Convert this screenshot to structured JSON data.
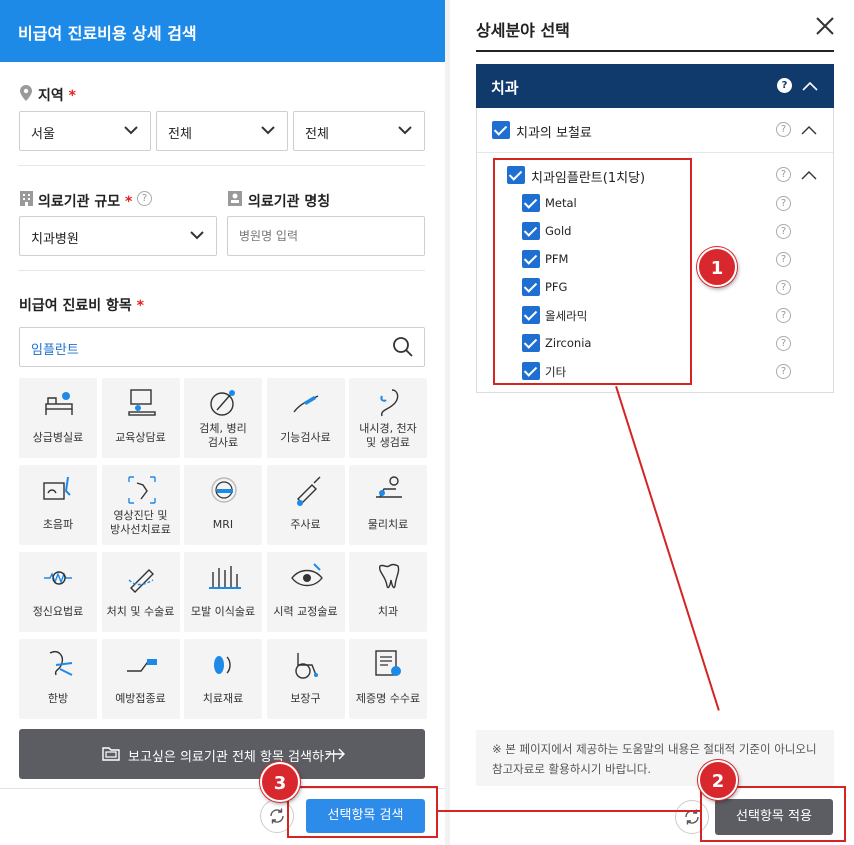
{
  "left": {
    "header_title": "비급여 진료비용 상세 검색",
    "region": {
      "title": "지역",
      "required_mark": "*",
      "selects": [
        "서울",
        "전체",
        "전체"
      ]
    },
    "scale": {
      "title": "의료기관 규모",
      "required_mark": "*",
      "value": "치과병원"
    },
    "name": {
      "title": "의료기관 명칭",
      "placeholder": "병원명 입력"
    },
    "items": {
      "title": "비급여 진료비 항목",
      "required_mark": "*",
      "search_value": "임플란트"
    },
    "categories": [
      {
        "label": "상급병실료",
        "icon": "hospital-bed-icon"
      },
      {
        "label": "교육상담료",
        "icon": "counseling-icon"
      },
      {
        "label": "검체, 병리\n검사료",
        "icon": "specimen-icon"
      },
      {
        "label": "기능검사료",
        "icon": "function-test-icon"
      },
      {
        "label": "내시경, 천자\n및 생검료",
        "icon": "endoscope-icon"
      },
      {
        "label": "초음파",
        "icon": "ultrasound-icon"
      },
      {
        "label": "영상진단 및\n방사선치료료",
        "icon": "radiology-icon"
      },
      {
        "label": "MRI",
        "icon": "mri-icon"
      },
      {
        "label": "주사료",
        "icon": "syringe-icon"
      },
      {
        "label": "물리치료",
        "icon": "physiotherapy-icon"
      },
      {
        "label": "정신요법료",
        "icon": "brain-wave-icon"
      },
      {
        "label": "처치 및 수술료",
        "icon": "surgery-icon"
      },
      {
        "label": "모발 이식술료",
        "icon": "hair-transplant-icon"
      },
      {
        "label": "시력 교정술료",
        "icon": "eye-icon"
      },
      {
        "label": "치과",
        "icon": "tooth-icon"
      },
      {
        "label": "한방",
        "icon": "acupuncture-icon"
      },
      {
        "label": "예방접종료",
        "icon": "vaccine-icon"
      },
      {
        "label": "치료재료",
        "icon": "material-icon"
      },
      {
        "label": "보장구",
        "icon": "wheelchair-icon"
      },
      {
        "label": "제증명 수수료",
        "icon": "certificate-icon"
      }
    ],
    "all_items_button": "보고싶은 의료기관 전체 항목 검색하기",
    "search_button": "선택항목 검색"
  },
  "right": {
    "title": "상세분야 선택",
    "section_title": "치과",
    "group": "치과의 보철료",
    "subgroup": "치과임플란트(1치당)",
    "options": [
      "Metal",
      "Gold",
      "PFM",
      "PFG",
      "올세라믹",
      "Zirconia",
      "기타"
    ],
    "help_mark": "?",
    "notice": "※ 본 페이지에서 제공하는 도움말의 내용은 절대적 기준이 아니오니참고자료로 활용하시기 바랍니다.",
    "apply_button": "선택항목 적용"
  },
  "annotations": [
    "1",
    "2",
    "3"
  ],
  "colors": {
    "primary": "#1e8ae8",
    "navy": "#0f3a6b",
    "annotation": "#d42424",
    "dark_button": "#5b5d63"
  }
}
